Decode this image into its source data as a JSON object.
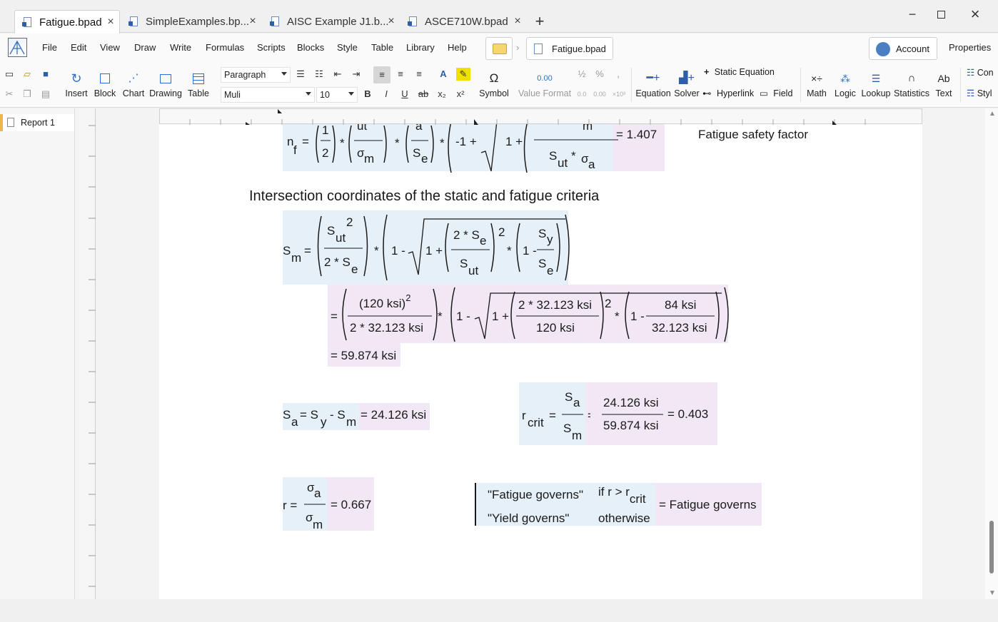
{
  "tabs": [
    {
      "label": "Fatigue.bpad",
      "active": true
    },
    {
      "label": "SimpleExamples.bp...",
      "active": false
    },
    {
      "label": "AISC Example J1.b...",
      "active": false
    },
    {
      "label": "ASCE710W.bpad",
      "active": false
    }
  ],
  "menu": [
    "File",
    "Edit",
    "View",
    "Draw",
    "Write",
    "Formulas",
    "Scripts",
    "Blocks",
    "Style",
    "Table",
    "Library",
    "Help"
  ],
  "breadcrumb_file": "Fatigue.bpad",
  "account_label": "Account",
  "properties_label": "Properties",
  "ribbon": {
    "insert": "Insert",
    "block": "Block",
    "chart": "Chart",
    "drawing": "Drawing",
    "table": "Table",
    "paragraph_style": "Paragraph",
    "font": "Muli",
    "font_size": "10",
    "symbol": "Symbol",
    "value_format": "Value Format",
    "equation": "Equation",
    "solver": "Solver",
    "static_equation": "Static Equation",
    "hyperlink": "Hyperlink",
    "field": "Field",
    "math": "Math",
    "logic": "Logic",
    "lookup": "Lookup",
    "statistics": "Statistics",
    "text": "Text",
    "con": "Con",
    "styl": "Styl",
    "value_format_icons": [
      "0.00",
      "½",
      "%",
      ",",
      "0.0",
      "0.00",
      "×10³"
    ]
  },
  "sidebar": {
    "report": "Report 1"
  },
  "doc": {
    "nf_result": "= 1.407",
    "nf_comment": "Fatigue safety factor",
    "heading": "Intersection coordinates of the static and fatigue criteria",
    "sm_eval_1": "(120 ksi)",
    "sm_eval_den1": "2 * 32.123 ksi",
    "sm_eval_num2": "2 * 32.123 ksi",
    "sm_eval_den2": "120 ksi",
    "sm_eval_num3": "84 ksi",
    "sm_eval_den3": "32.123 ksi",
    "sm_result": "= 59.874 ksi",
    "sa_result": "= 24.126 ksi",
    "rcrit_num": "24.126 ksi",
    "rcrit_den": "59.874 ksi",
    "rcrit_result": "= 0.403",
    "r_result": "= 0.667",
    "case1": "\"Fatigue governs\"",
    "case2": "\"Yield governs\"",
    "cond1": "if r > r",
    "cond2": "otherwise",
    "gov_result": "= Fatigue governs"
  }
}
